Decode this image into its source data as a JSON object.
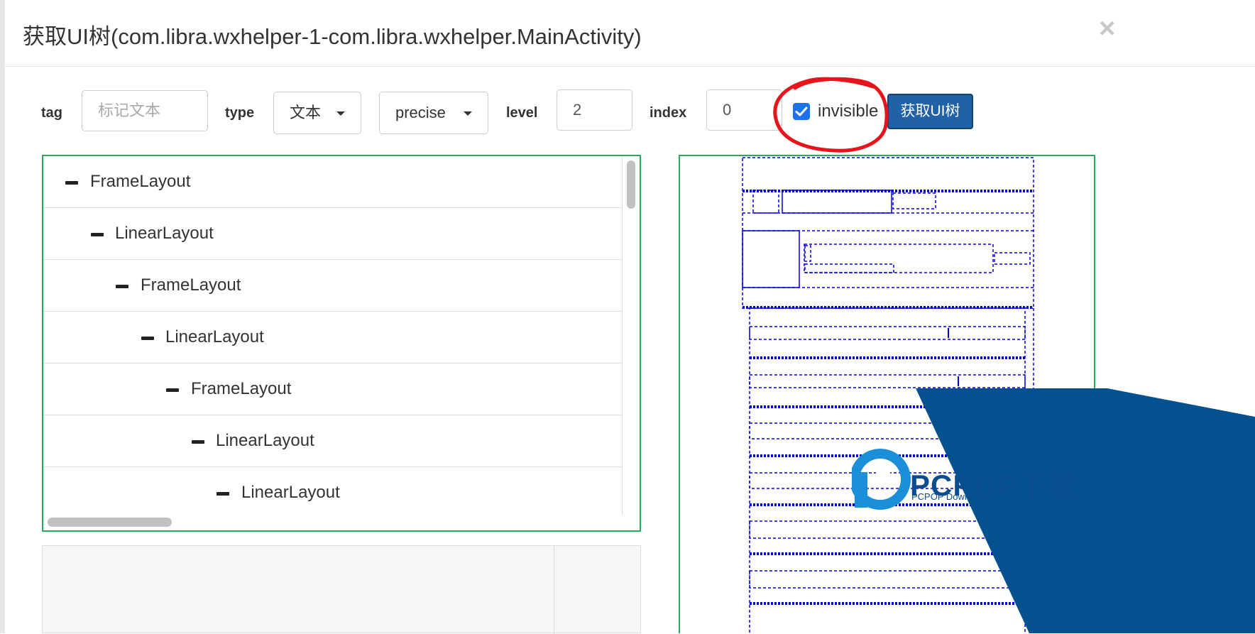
{
  "modal": {
    "title": "获取UI树(com.libra.wxhelper-1-com.libra.wxhelper.MainActivity)",
    "close_label": "×"
  },
  "toolbar": {
    "tag_label": "tag",
    "tag_placeholder": "标记文本",
    "type_label": "type",
    "type_value": "文本",
    "mode_value": "precise",
    "level_label": "level",
    "level_value": "2",
    "index_label": "index",
    "index_value": "0",
    "invisible_label": "invisible",
    "invisible_checked": true,
    "fetch_button_label": "获取UI树"
  },
  "tree": {
    "nodes": [
      {
        "name": "FrameLayout",
        "depth": 0
      },
      {
        "name": "LinearLayout",
        "depth": 1
      },
      {
        "name": "FrameLayout",
        "depth": 2
      },
      {
        "name": "LinearLayout",
        "depth": 3
      },
      {
        "name": "FrameLayout",
        "depth": 4
      },
      {
        "name": "LinearLayout",
        "depth": 5
      },
      {
        "name": "LinearLayout",
        "depth": 6
      }
    ]
  },
  "watermark": {
    "title": "PCPOP下载",
    "subtitle": "PCPOP Download"
  },
  "colors": {
    "accent": "#2161a8",
    "panel_border": "#2aa75b",
    "preview_lines": "#0000dd",
    "annotation": "#e8141c"
  }
}
